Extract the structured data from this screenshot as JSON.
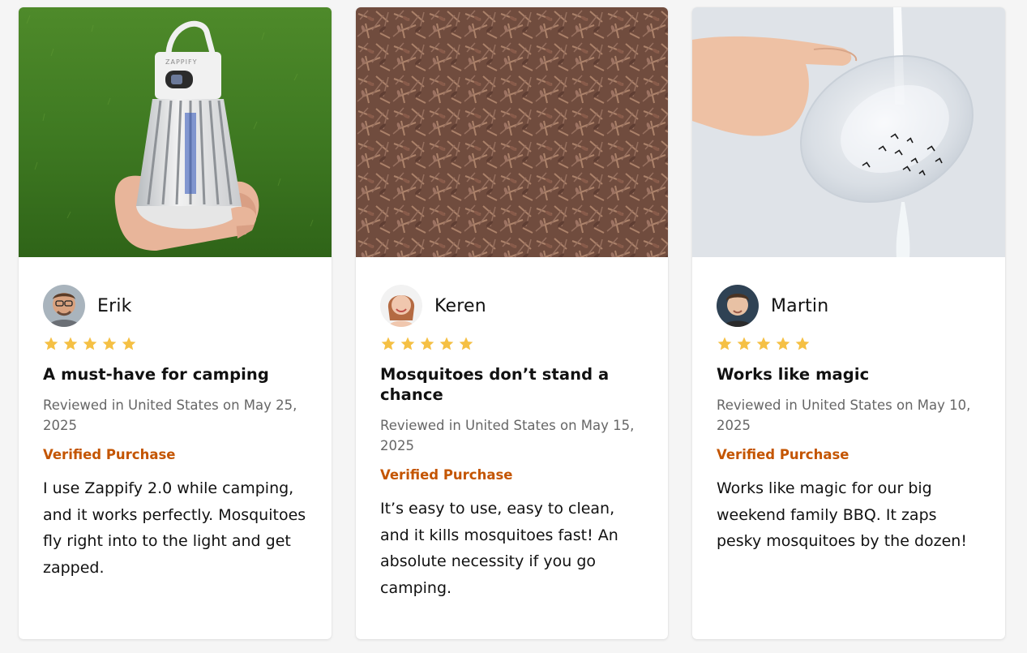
{
  "colors": {
    "star": "#f5c044",
    "verified": "#c45500",
    "meta": "#666666"
  },
  "reviews": [
    {
      "name": "Erik",
      "rating": 5,
      "title": "A must-have for camping",
      "meta": "Reviewed in United States on May 25, 2025",
      "verified": "Verified Purchase",
      "text": "I use Zappify 2.0 while camping, and it works perfectly. Mosquitoes fly right into to the light and get zapped.",
      "device_brand": "ZAPPIFY"
    },
    {
      "name": "Keren",
      "rating": 5,
      "title": "Mosquitoes don’t stand a chance",
      "meta": "Reviewed in United States on May 15, 2025",
      "verified": "Verified Purchase",
      "text": "It’s easy to use, easy to clean, and it kills mosquitoes fast! An absolute necessity if you go camping."
    },
    {
      "name": "Martin",
      "rating": 5,
      "title": "Works like magic",
      "meta": "Reviewed in United States on May 10, 2025",
      "verified": "Verified Purchase",
      "text": "Works like magic for our big weekend family BBQ. It zaps pesky mosquitoes by the dozen!"
    }
  ]
}
